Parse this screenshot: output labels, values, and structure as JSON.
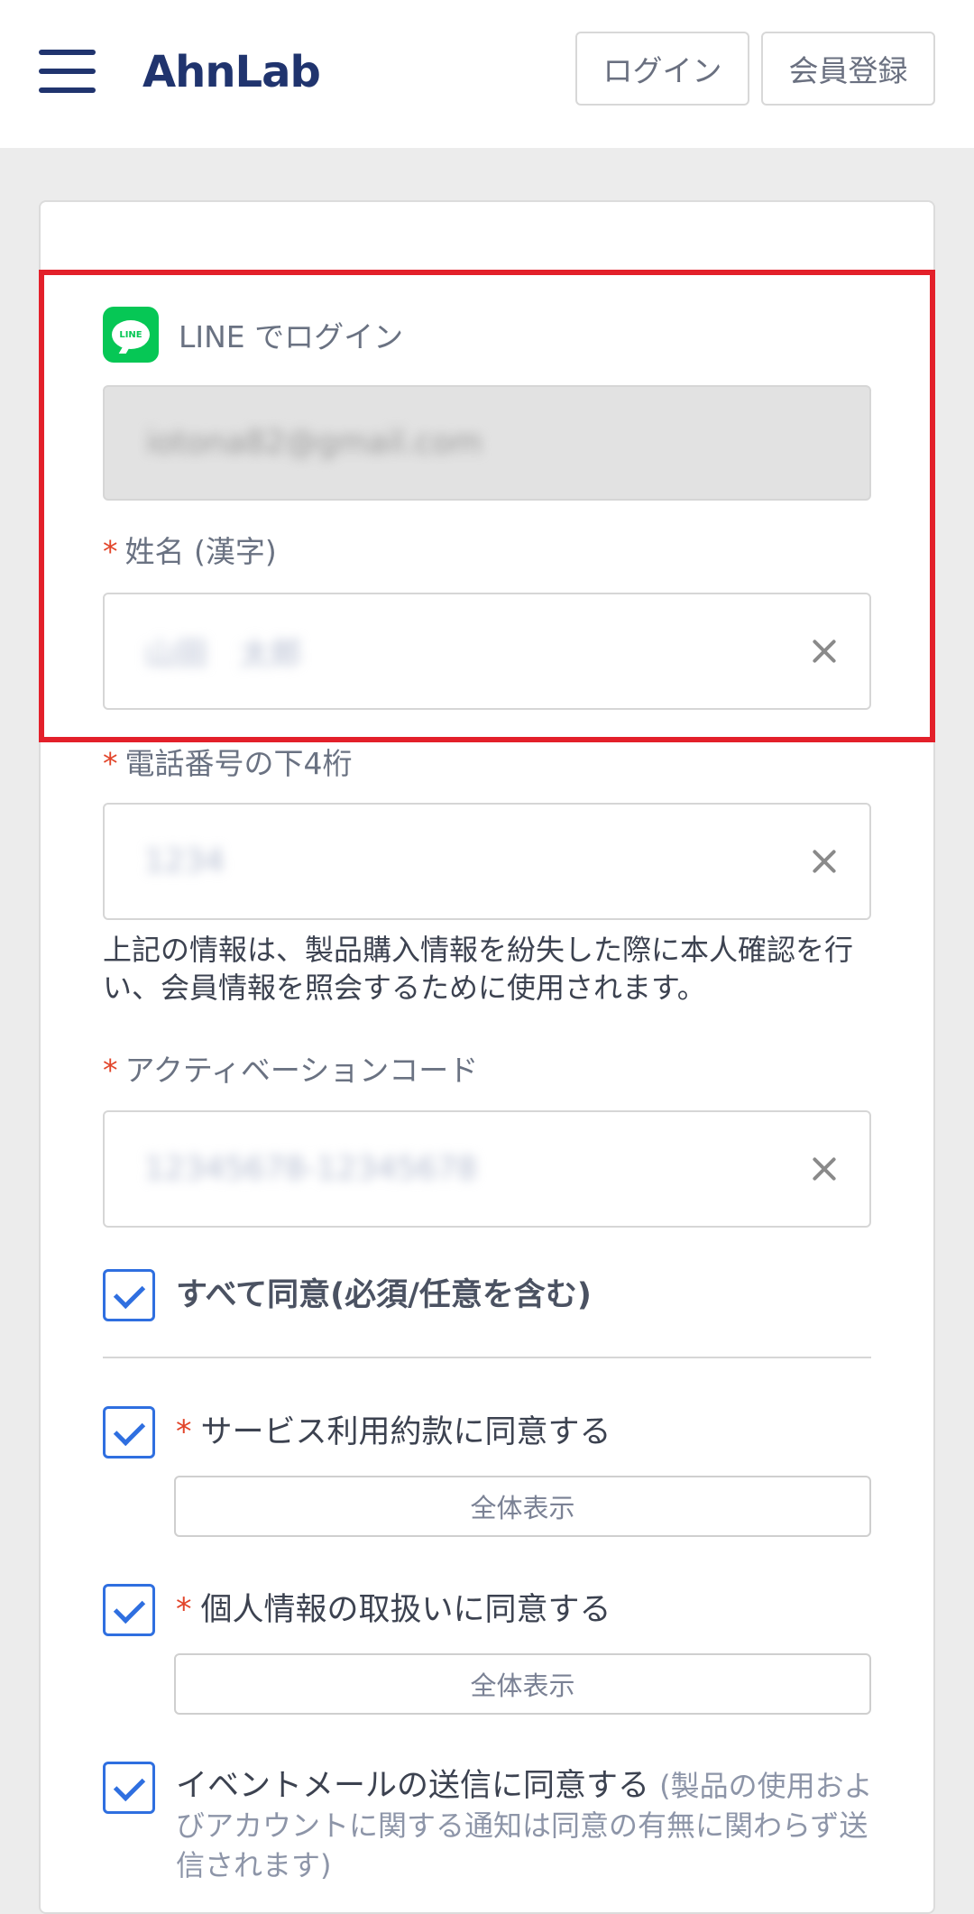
{
  "header": {
    "logo": "AhnLab",
    "login_label": "ログイン",
    "signup_label": "会員登録"
  },
  "form": {
    "line_login_label": "LINE でログイン",
    "line_icon_text": "LINE",
    "email_value": "iotona82@gmail.com",
    "name_label": "姓名 (漢字)",
    "name_value": "山田　太郎",
    "phone_label": "電話番号の下4桁",
    "phone_value": "1234",
    "info_text": "上記の情報は、製品購入情報を紛失した際に本人確認を行い、会員情報を照会するために使用されます。",
    "activation_label": "アクティベーションコード",
    "activation_value": "12345678-12345678",
    "required_mark": "*"
  },
  "agreements": {
    "agree_all": "すべて同意(必須/任意を含む)",
    "terms": "サービス利用約款に同意する",
    "privacy": "個人情報の取扱いに同意する",
    "view_all": "全体表示",
    "event_mail": "イベントメールの送信に同意する",
    "event_note": "(製品の使用およびアカウントに関する通知は同意の有無に関わらず送信されます)"
  },
  "colors": {
    "brand": "#20346e",
    "highlight": "#e3202a",
    "line_green": "#06c755",
    "checkbox_blue": "#2f6fe0",
    "required": "#e2452a"
  }
}
